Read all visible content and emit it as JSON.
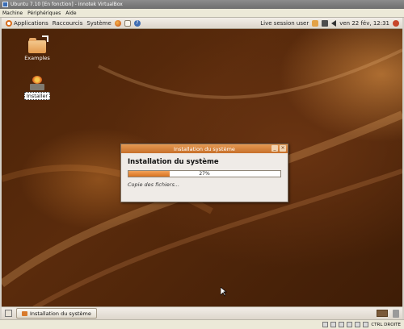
{
  "host": {
    "title": "Ubuntu 7.10 [En fonction] - innotek VirtualBox",
    "menu": [
      "Machine",
      "Périphériques",
      "Aide"
    ],
    "status_host_key": "CTRL DROITE"
  },
  "top_panel": {
    "menus": [
      "Applications",
      "Raccourcis",
      "Système"
    ],
    "session_label": "Live session user",
    "clock": "ven 22 fév, 12:31"
  },
  "desktop_icons": [
    {
      "label": "Examples"
    },
    {
      "label": "Installer"
    }
  ],
  "dialog": {
    "title": "Installation du système",
    "heading": "Installation du système",
    "progress_text": "27%",
    "progress_value": 0.27,
    "status": "Copie des fichiers..."
  },
  "taskbar": {
    "task_label": "Installation du système"
  },
  "colors": {
    "accent": "#d8711f",
    "desktop_bg": "#4b2308"
  }
}
